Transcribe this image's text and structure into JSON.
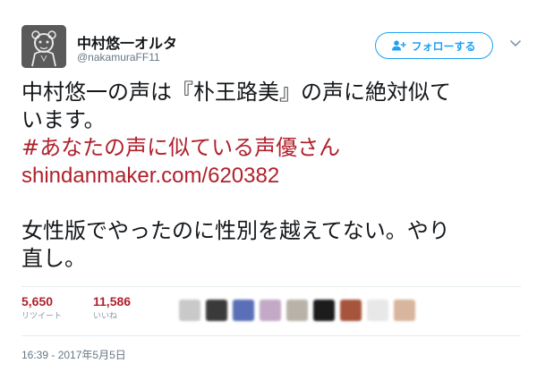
{
  "user": {
    "display_name": "中村悠一オルタ",
    "handle": "@nakamuraFF11",
    "avatar_icon": "avatar-sketch-icon"
  },
  "follow": {
    "label": "フォローする",
    "icon": "add-user-icon",
    "color": "#1da1f2"
  },
  "menu": {
    "icon": "chevron-down-icon"
  },
  "tweet": {
    "line1": "中村悠一の声は『朴王路美』の声に絶対似て",
    "line2": "います。",
    "hashtag": "#あなたの声に似ている声優さん",
    "link": "shindanmaker.com/620382",
    "line3": "女性版でやったのに性別を越えてない。やり",
    "line4": "直し。"
  },
  "stats": {
    "retweets_count": "5,650",
    "retweets_label": "リツイート",
    "likes_count": "11,586",
    "likes_label": "いいね",
    "accent_color": "#b0212c"
  },
  "timestamp": "16:39 - 2017年5月5日"
}
